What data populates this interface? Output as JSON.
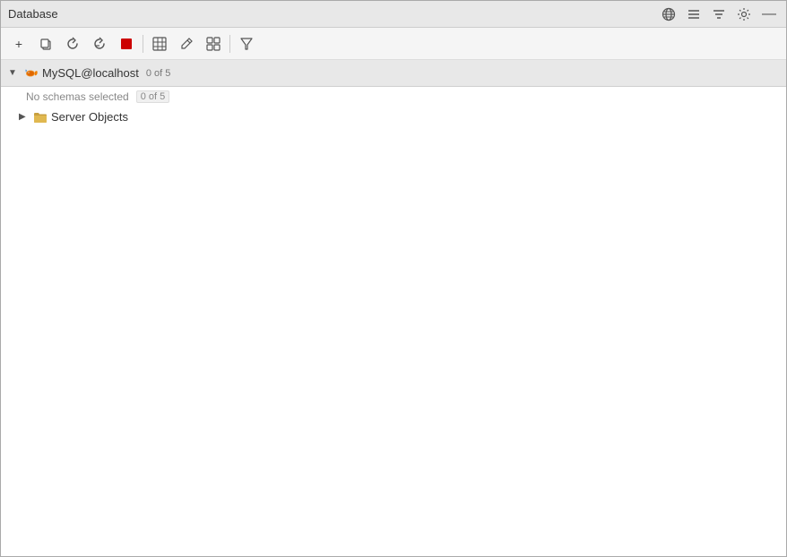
{
  "window": {
    "title": "Database"
  },
  "titlebar": {
    "title": "Database",
    "icons": {
      "globe": "⊕",
      "list": "≡",
      "filter_list": "≈",
      "settings": "⚙",
      "minimize": "—"
    }
  },
  "toolbar": {
    "buttons": [
      {
        "name": "add",
        "label": "+",
        "icon": "+"
      },
      {
        "name": "copy",
        "label": "⧉",
        "icon": "⧉"
      },
      {
        "name": "refresh",
        "label": "↺",
        "icon": "↺"
      },
      {
        "name": "refresh-all",
        "label": "⟳",
        "icon": "⟳"
      },
      {
        "name": "stop",
        "label": "■",
        "icon": "■",
        "color": "red"
      },
      {
        "name": "separator1"
      },
      {
        "name": "table",
        "label": "▦",
        "icon": "▦"
      },
      {
        "name": "edit",
        "label": "✎",
        "icon": "✎"
      },
      {
        "name": "view",
        "label": "▣",
        "icon": "▣"
      },
      {
        "name": "separator2"
      },
      {
        "name": "filter",
        "label": "⊿",
        "icon": "⊿"
      }
    ]
  },
  "tree": {
    "root": {
      "label": "MySQL@localhost",
      "badge": "0 of 5",
      "expanded": true
    },
    "schema_row": {
      "label": "No schemas selected",
      "badge": "0 of 5"
    },
    "items": [
      {
        "label": "Server Objects",
        "type": "folder",
        "expanded": false
      }
    ]
  }
}
